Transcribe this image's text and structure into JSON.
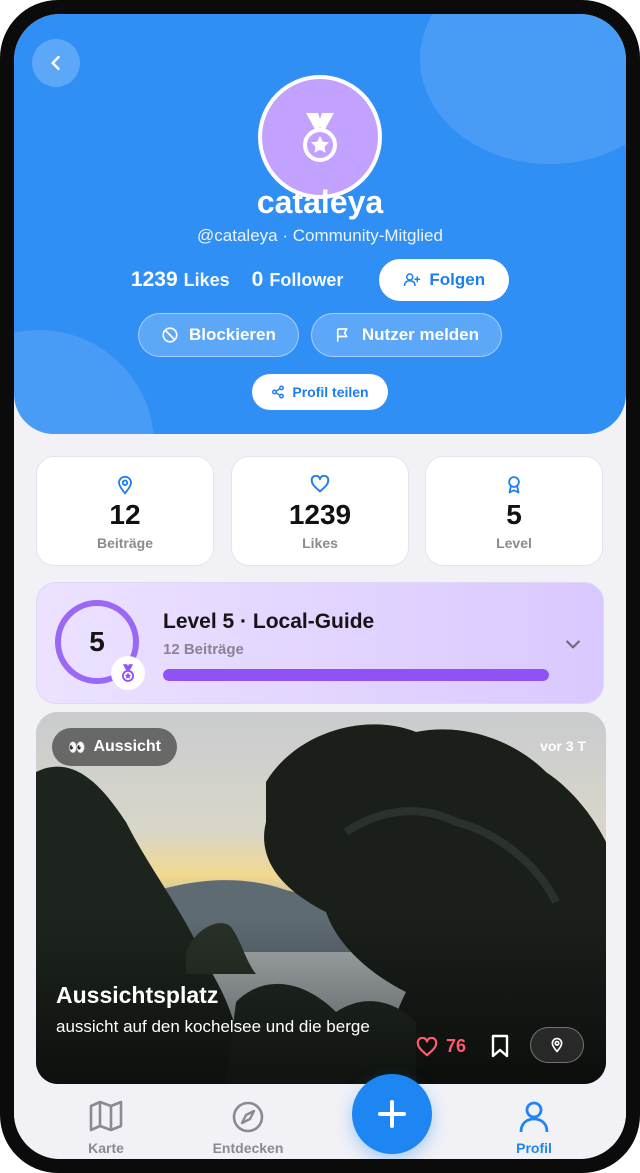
{
  "profile": {
    "username": "cataleya",
    "handle": "@cataleya · Community-Mitglied",
    "likes_count": "1239",
    "likes_label": "Likes",
    "followers_count": "0",
    "followers_label": "Follower",
    "follow_label": "Folgen",
    "block_label": "Blockieren",
    "report_label": "Nutzer melden",
    "share_label": "Profil teilen",
    "avatar_icon": "medal-icon"
  },
  "stats": [
    {
      "icon": "map-pin-icon",
      "value": "12",
      "label": "Beiträge"
    },
    {
      "icon": "heart-icon",
      "value": "1239",
      "label": "Likes"
    },
    {
      "icon": "award-icon",
      "value": "5",
      "label": "Level"
    }
  ],
  "level": {
    "number": "5",
    "title": "Level 5 · Local-Guide",
    "subtitle": "12 Beiträge",
    "progress": 1.0
  },
  "post": {
    "tag_emoji": "👀",
    "tag_label": "Aussicht",
    "time": "vor 3 T",
    "title": "Aussichtsplatz",
    "description": "aussicht auf den kochelsee und die berge",
    "likes": "76"
  },
  "tabs": [
    {
      "label": "Karte",
      "icon": "map-icon"
    },
    {
      "label": "Entdecken",
      "icon": "compass-icon"
    },
    {
      "label": "Profil",
      "icon": "user-icon",
      "active": true
    }
  ],
  "colors": {
    "hero": "#2f8ff5",
    "accent": "#1d86f3",
    "level_purple": "#8e52f5",
    "like_red": "#ff5a6e"
  }
}
